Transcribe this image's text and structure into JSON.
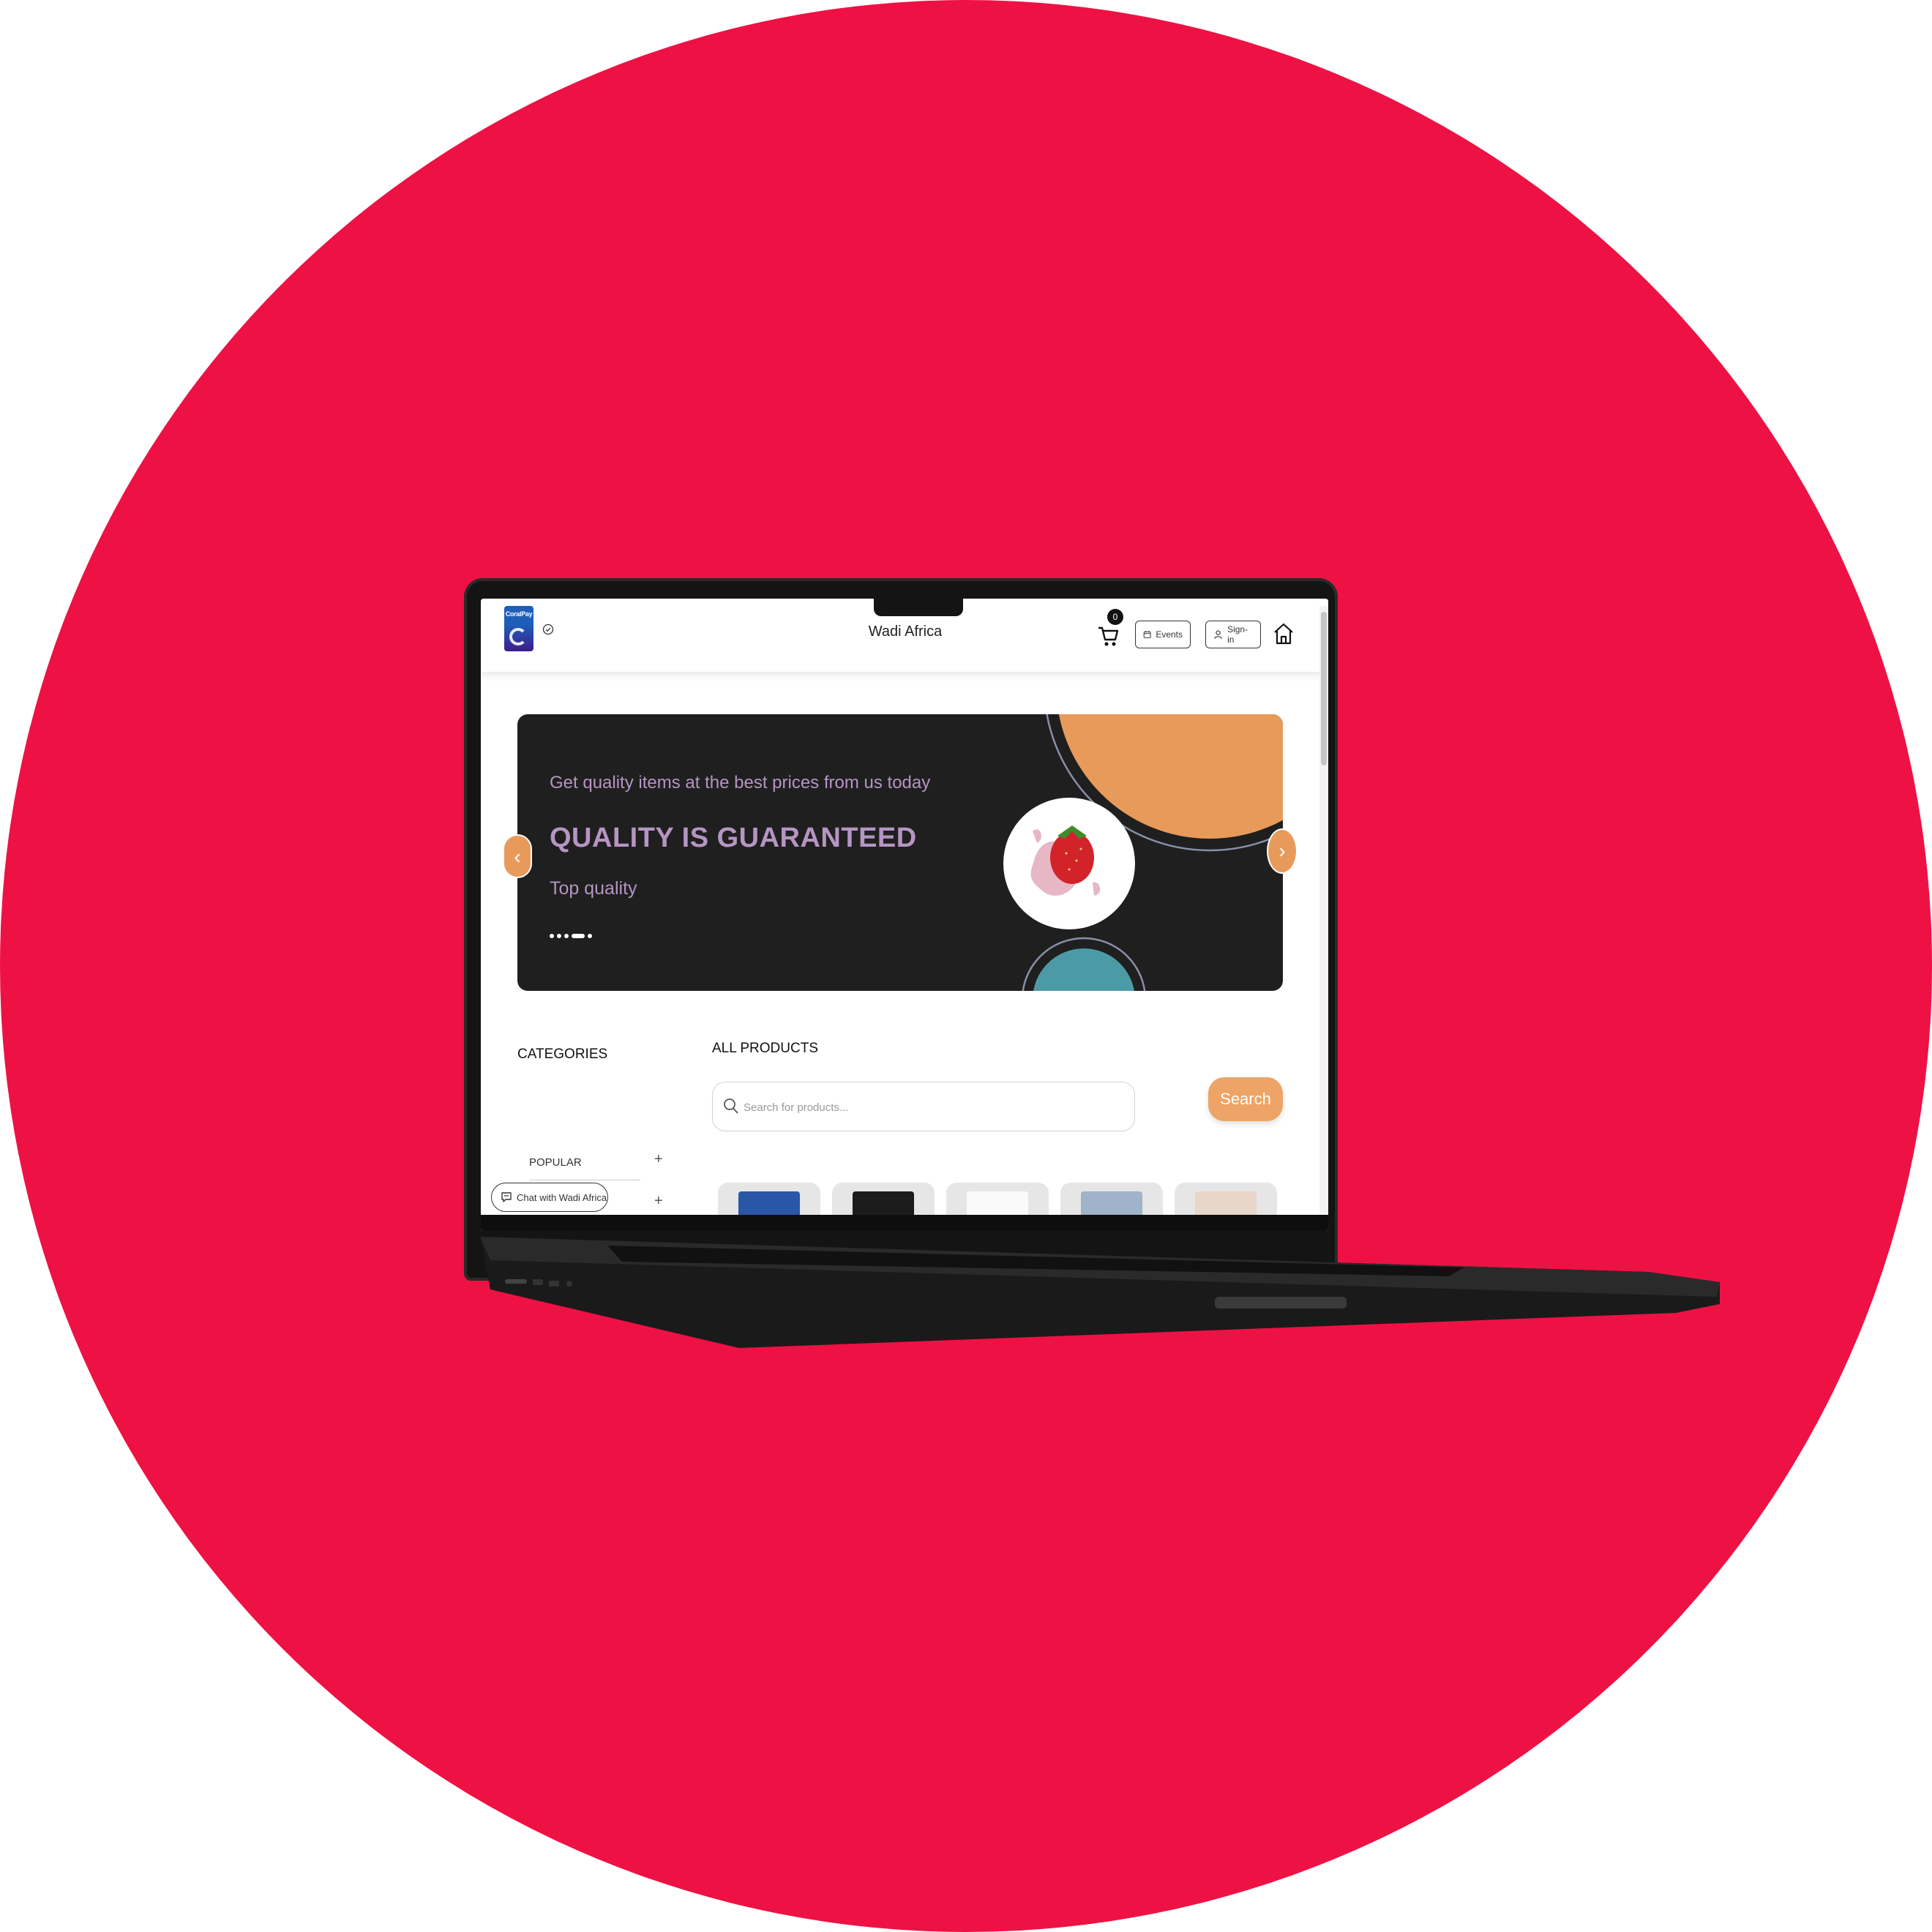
{
  "header": {
    "logo_text": "CoralPay",
    "title": "Wadi Africa",
    "cart_count": "0",
    "events_label": "Events",
    "signin_label": "Sign-in"
  },
  "hero": {
    "subtitle": "Get quality items at the best prices from us today",
    "title": "QUALITY IS GUARANTEED",
    "tagline": "Top quality",
    "prev_arrow": "‹",
    "next_arrow": "›",
    "slide_count": 4,
    "active_slide": 4
  },
  "categories": {
    "title": "CATEGORIES",
    "items": [
      {
        "label": "POPULAR",
        "toggle": "+"
      },
      {
        "label": "",
        "toggle": "+"
      }
    ]
  },
  "products": {
    "title": "ALL PRODUCTS",
    "search_placeholder": "Search for products...",
    "search_button": "Search"
  },
  "chat": {
    "label": "Chat with Wadi Africa"
  },
  "colors": {
    "background_circle": "#ee1144",
    "accent": "#eea466",
    "hero_text": "#b595c2",
    "hero_bg": "#1f1f1f"
  }
}
